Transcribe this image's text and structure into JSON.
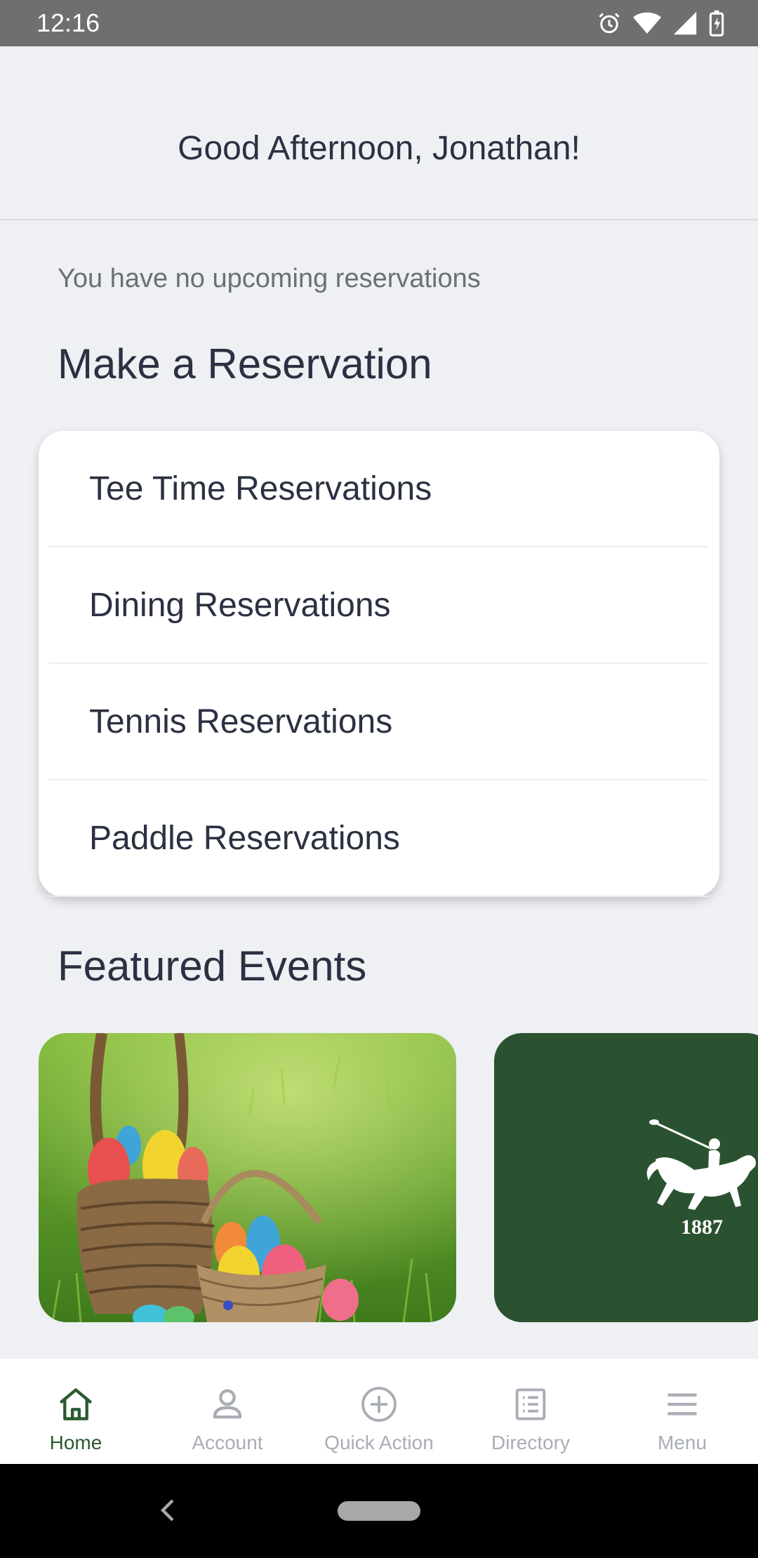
{
  "status_bar": {
    "time": "12:16"
  },
  "header": {
    "greeting": "Good Afternoon, Jonathan!"
  },
  "reservations": {
    "empty_message": "You have no upcoming reservations",
    "section_title": "Make a Reservation",
    "items": [
      {
        "label": "Tee Time Reservations"
      },
      {
        "label": "Dining Reservations"
      },
      {
        "label": "Tennis Reservations"
      },
      {
        "label": "Paddle Reservations"
      }
    ]
  },
  "events": {
    "section_title": "Featured Events",
    "cards": [
      {
        "name": "easter-egg-basket-photo"
      },
      {
        "name": "club-logo",
        "logo_text": "1887",
        "background": "#2a5230"
      }
    ]
  },
  "bottom_nav": {
    "items": [
      {
        "label": "Home",
        "icon": "home-icon",
        "active": true
      },
      {
        "label": "Account",
        "icon": "person-icon",
        "active": false
      },
      {
        "label": "Quick Action",
        "icon": "plus-circle-icon",
        "active": false
      },
      {
        "label": "Directory",
        "icon": "list-icon",
        "active": false
      },
      {
        "label": "Menu",
        "icon": "hamburger-icon",
        "active": false
      }
    ]
  },
  "colors": {
    "accent": "#2a5a30",
    "inactive": "#a9adb5",
    "text": "#2b3142"
  }
}
